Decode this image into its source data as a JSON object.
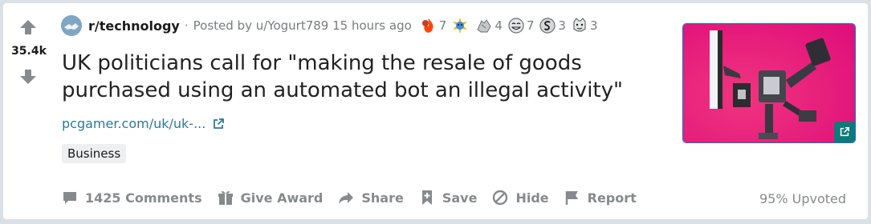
{
  "vote": {
    "score": "35.4k"
  },
  "post": {
    "subreddit": "r/technology",
    "separator": "·",
    "posted_by": "Posted by u/Yogurt789 15 hours ago",
    "awards": [
      {
        "icon": "fire-award-icon",
        "count": "7"
      },
      {
        "icon": "wholesome-award-icon",
        "count": ""
      },
      {
        "icon": "silver-hands-award-icon",
        "count": "4"
      },
      {
        "icon": "laughing-award-icon",
        "count": "7"
      },
      {
        "icon": "s-coin-award-icon",
        "count": "3"
      },
      {
        "icon": "face-award-icon",
        "count": "3"
      }
    ],
    "title": "UK politicians call for \"making the resale of goods purchased using an automated bot an illegal activity\"",
    "link_text": "pcgamer.com/uk/uk-...",
    "flair": "Business"
  },
  "actions": {
    "comments": "1425 Comments",
    "award": "Give Award",
    "share": "Share",
    "save": "Save",
    "hide": "Hide",
    "report": "Report"
  },
  "upvoted": "95% Upvoted",
  "colors": {
    "thumbnail_bg": "#e8117a",
    "link": "#2a7a9a",
    "muted": "#878a8c"
  }
}
